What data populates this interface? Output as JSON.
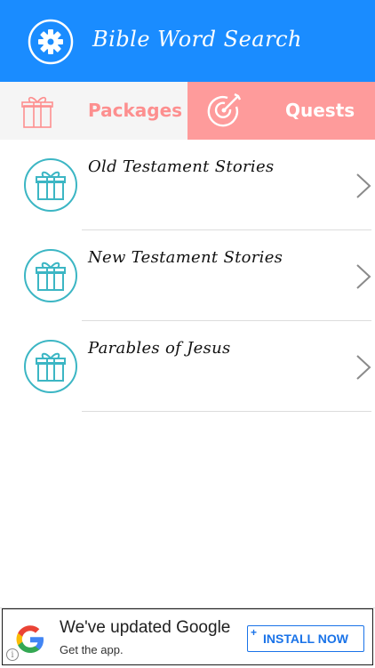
{
  "header": {
    "title": "Bible Word Search",
    "settings_icon": "gear-icon",
    "background_color": "#1a8cff"
  },
  "tabs": [
    {
      "label": "Packages",
      "icon": "gift-icon",
      "selected": true,
      "color": "#fd8f8f"
    },
    {
      "label": "Quests",
      "icon": "target-arrow-icon",
      "selected": false,
      "color": "#fe9b9b"
    }
  ],
  "packages": [
    {
      "title": "Old Testament Stories",
      "icon": "gift-icon"
    },
    {
      "title": "New Testament Stories",
      "icon": "gift-icon"
    },
    {
      "title": "Parables of Jesus",
      "icon": "gift-icon"
    }
  ],
  "ad": {
    "headline": "We've updated Google",
    "subtext": "Get the app.",
    "install_label": "INSTALL NOW",
    "plus": "+",
    "info": "i",
    "accent_color": "#1a73e8"
  }
}
